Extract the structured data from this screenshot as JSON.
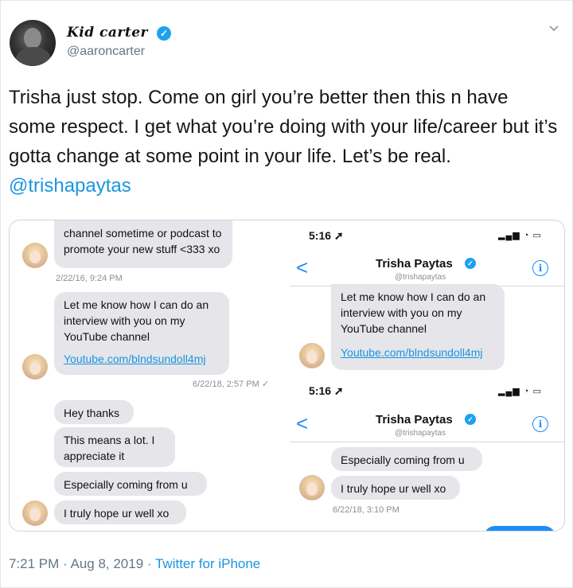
{
  "tweet": {
    "display_name": "Kid carter",
    "handle": "@aaroncarter",
    "text": "Trisha just stop. Come on girl you’re better then this n have some respect. I get what you’re doing with your life/career but it’s gotta change at some point in your life. Let’s be real.",
    "mention": "@trishapaytas",
    "timestamp": "7:21 PM · Aug 8, 2019",
    "separator": " · ",
    "client": "Twitter for iPhone"
  },
  "left_screenshot": {
    "msg1": "channel sometime or podcast to promote your new stuff <333 xo",
    "date1": "2/22/16, 9:24 PM",
    "msg2": "Let me know how I can do an interview with you on my YouTube channel",
    "link2": "Youtube.com/blndsundoll4mj",
    "date2": "6/22/18, 2:57 PM ✓",
    "msg3": "Hey thanks",
    "msg4": "This means a lot.  I appreciate it",
    "msg5": "Especially coming from u",
    "msg6": "I truly hope ur well xo"
  },
  "right_screenshot_1": {
    "time": "5:16",
    "signal": "▂▄▆ ◔ ▭",
    "back": "<",
    "contact_name": "Trisha Paytas",
    "contact_handle": "@trishapaytas",
    "info": "i",
    "msg1": "Let me know how I can do an interview with you on my YouTube channel",
    "link1": "Youtube.com/blndsundoll4mj"
  },
  "right_screenshot_2": {
    "time": "5:16",
    "signal": "▂▄▆ ◔ ▭",
    "back": "<",
    "contact_name": "Trisha Paytas",
    "contact_handle": "@trishapaytas",
    "info": "i",
    "msg1": "Especially coming from u",
    "msg2": "I truly hope ur well xo",
    "date": "6/22/18, 3:10 PM"
  },
  "icons": {
    "verified": "✓",
    "chevron": "chevron-down-icon",
    "location": "➚"
  },
  "colors": {
    "link_blue": "#1b95e0",
    "verified_blue": "#1da1f2",
    "imessage_blue": "#1d8cf8",
    "bubble_gray": "#e5e5ea",
    "meta_gray": "#657786"
  }
}
